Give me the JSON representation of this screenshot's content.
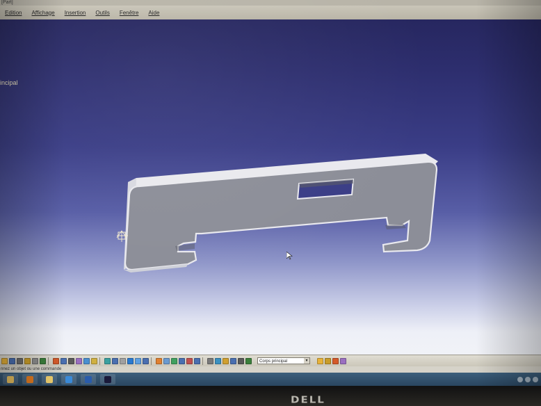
{
  "window": {
    "title": "[Part]"
  },
  "menu": {
    "items": [
      {
        "label": "Edition"
      },
      {
        "label": "Affichage"
      },
      {
        "label": "Insertion"
      },
      {
        "label": "Outils"
      },
      {
        "label": "Fenêtre"
      },
      {
        "label": "Aide"
      }
    ]
  },
  "tree": {
    "root_label": "incipal"
  },
  "toolbar": {
    "body_select_value": "Corps principal",
    "icon_colors": [
      "#e7b23a",
      "#4a6fb0",
      "#6b6b6b",
      "#c89c2a",
      "#8a8a8a",
      "#3b7f3b",
      "#d45a2a",
      "#4a6fb0",
      "#5a5a5a",
      "#9a6fc0",
      "#4a8fd0",
      "#d0b040",
      "#3aa0a0",
      "#4a6fb0",
      "#a0a0a0",
      "#2a7ad0",
      "#5fa0e0",
      "#4a6fb0",
      "#e08030",
      "#6a9ad0",
      "#40a060",
      "#4a6fb0",
      "#c05050",
      "#4a6fb0",
      "#7a7a7a",
      "#3a90c0",
      "#d0a030",
      "#4a6fb0",
      "#5a5a5a",
      "#3b7f3b"
    ]
  },
  "status": {
    "prompt": "nnez un objet ou une commande"
  },
  "taskbar": {
    "apps": [
      {
        "name": "folder-icon",
        "color": "#e8c060"
      },
      {
        "name": "media-player-icon",
        "color": "#e07a20"
      },
      {
        "name": "explorer-icon",
        "color": "#f0d070"
      },
      {
        "name": "ie-icon",
        "color": "#3a8ad8"
      },
      {
        "name": "word-icon",
        "color": "#2a5caa"
      },
      {
        "name": "catia-icon",
        "color": "#1a1a3a"
      }
    ]
  },
  "monitor": {
    "brand": "DELL"
  },
  "colors": {
    "part_face": "#8c8e98",
    "part_edge": "#e9e9ee",
    "part_shadow": "#5a5c66"
  }
}
